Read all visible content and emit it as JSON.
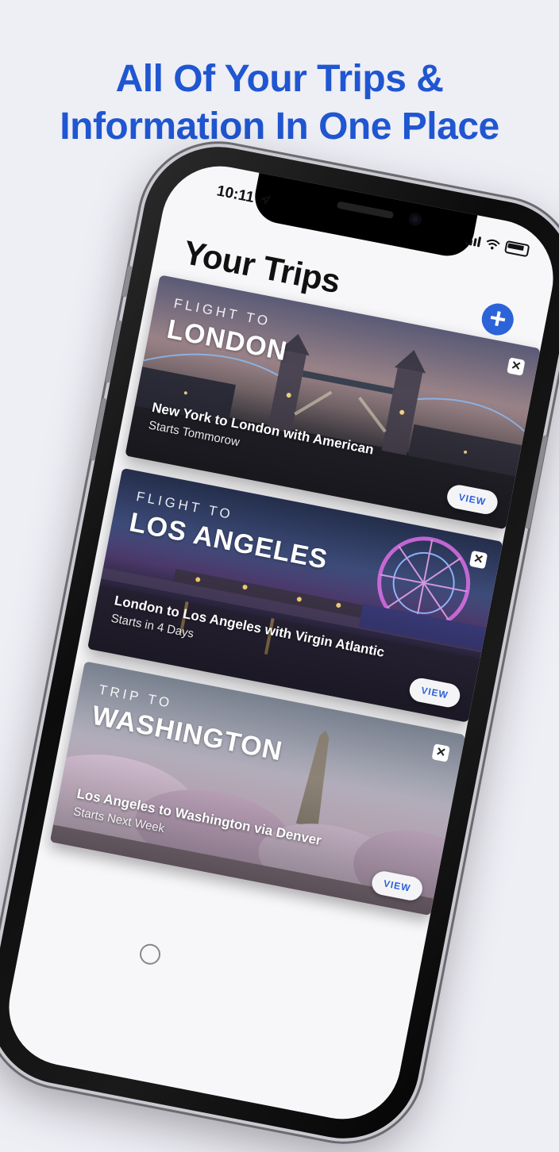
{
  "headline": {
    "line1": "All Of Your Trips &",
    "line2": "Information In One Place"
  },
  "status_bar": {
    "time": "10:11"
  },
  "screen": {
    "title": "Your Trips",
    "add_button_label": "+"
  },
  "trips": [
    {
      "kicker": "FLIGHT TO",
      "destination": "LONDON",
      "route": "New York to London with American",
      "start": "Starts Tommorow",
      "close_label": "✕",
      "view_label": "VIEW"
    },
    {
      "kicker": "FLIGHT TO",
      "destination": "LOS ANGELES",
      "route": "London to Los Angeles with Virgin Atlantic",
      "start": "Starts in 4 Days",
      "close_label": "✕",
      "view_label": "VIEW"
    },
    {
      "kicker": "TRIP TO",
      "destination": "WASHINGTON",
      "route": "Los Angeles to Washington via Denver",
      "start": "Starts Next Week",
      "close_label": "✕",
      "view_label": "VIEW"
    }
  ],
  "colors": {
    "accent": "#2c63d9",
    "headline": "#1f56d1",
    "background": "#eeeef5"
  },
  "icons": {
    "location": "location-arrow-icon",
    "signal": "cellular-signal-icon",
    "wifi": "wifi-icon",
    "battery": "battery-icon",
    "add": "plus-icon",
    "close": "close-icon"
  }
}
